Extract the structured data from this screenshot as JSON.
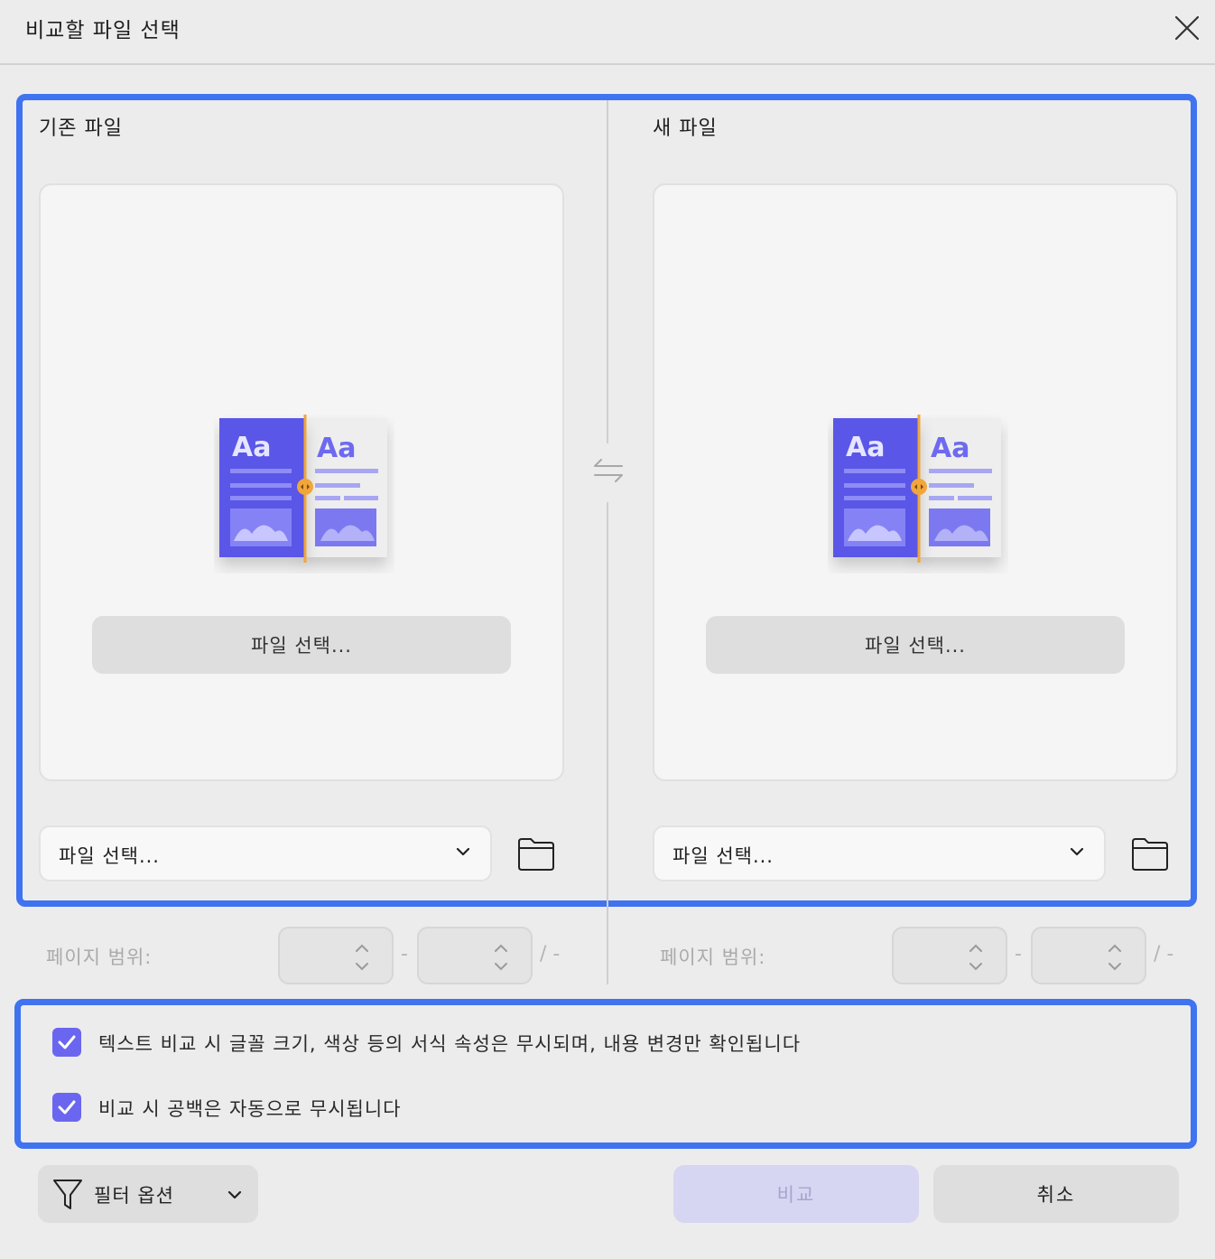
{
  "window": {
    "title": "비교할 파일 선택"
  },
  "old_pane": {
    "label": "기존 파일",
    "choose_button": "파일 선택...",
    "file_select_value": "파일 선택...",
    "page_range_label": "페이지 범위:",
    "range_separator": "-",
    "range_total": "/ -"
  },
  "new_pane": {
    "label": "새 파일",
    "choose_button": "파일 선택...",
    "file_select_value": "파일 선택...",
    "page_range_label": "페이지 범위:",
    "range_separator": "-",
    "range_total": "/ -"
  },
  "illustration": {
    "text_left": "Aa",
    "text_right": "Aa"
  },
  "options": [
    {
      "label": "텍스트 비교 시 글꼴 크기, 색상 등의 서식 속성은 무시되며, 내용 변경만 확인됩니다",
      "checked": true
    },
    {
      "label": "비교 시 공백은 자동으로 무시됩니다",
      "checked": true
    }
  ],
  "footer": {
    "filter_label": "필터 옵션",
    "compare_label": "비교",
    "cancel_label": "취소"
  },
  "icons": {
    "close": "close-icon",
    "swap": "swap-icon",
    "folder": "folder-icon",
    "dropdown": "chevron-down-icon",
    "stepper": "up-down-arrows-icon",
    "filter": "filter-funnel-icon",
    "check": "checkmark-icon"
  },
  "colors": {
    "accent": "#6b66f0",
    "highlight_frame": "#3f73f0",
    "compare_disabled_bg": "#d6d6f3",
    "illustration_purple": "#5a57e8",
    "illustration_orange": "#f0a63a"
  }
}
